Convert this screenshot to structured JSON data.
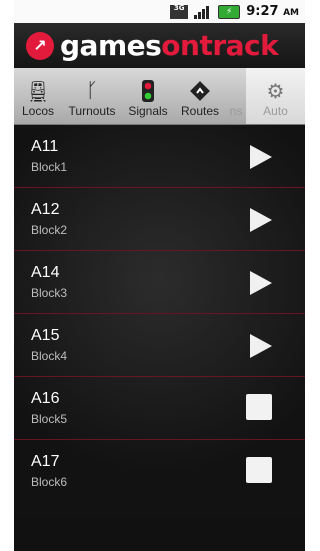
{
  "status_bar": {
    "time": "9:27",
    "ampm": "AM",
    "network": "3G"
  },
  "brand": {
    "part1": "games",
    "part2": "on",
    "part3": "track"
  },
  "tabs": [
    {
      "label": "Locos",
      "icon": "train-icon"
    },
    {
      "label": "Turnouts",
      "icon": "turnout-icon"
    },
    {
      "label": "Signals",
      "icon": "traffic-light-icon"
    },
    {
      "label": "Routes",
      "icon": "route-diamond-icon"
    },
    {
      "label": "ns",
      "icon": ""
    },
    {
      "label": "Auto",
      "icon": "gear-icon"
    }
  ],
  "blocks": [
    {
      "name": "A11",
      "block": "Block1",
      "state": "play"
    },
    {
      "name": "A12",
      "block": "Block2",
      "state": "play"
    },
    {
      "name": "A14",
      "block": "Block3",
      "state": "play"
    },
    {
      "name": "A15",
      "block": "Block4",
      "state": "play"
    },
    {
      "name": "A16",
      "block": "Block5",
      "state": "stop"
    },
    {
      "name": "A17",
      "block": "Block6",
      "state": "stop"
    }
  ]
}
